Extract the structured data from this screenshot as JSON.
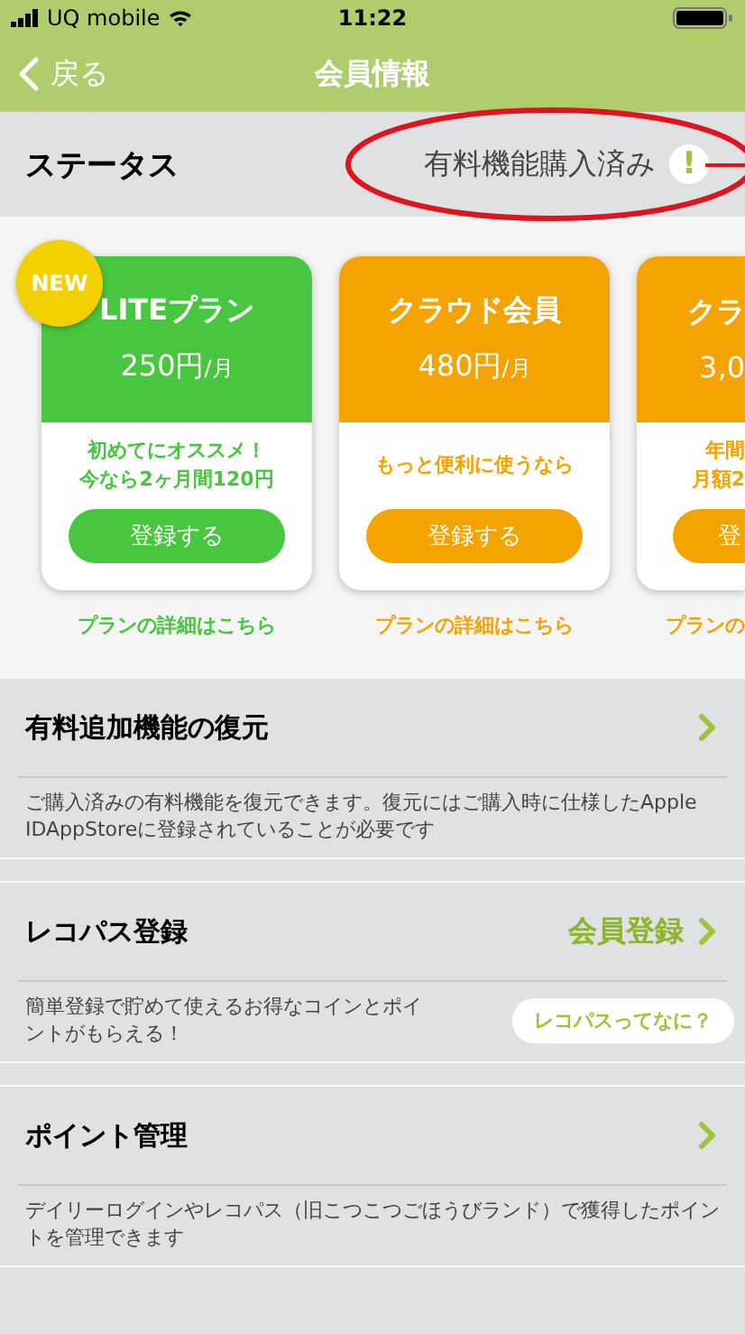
{
  "status_bar": {
    "carrier": "UQ mobile",
    "time": "11:22"
  },
  "nav": {
    "back": "戻る",
    "title": "会員情報"
  },
  "status_row": {
    "label": "ステータス",
    "value": "有料機能購入済み",
    "alert": "!"
  },
  "plans": [
    {
      "name": "LITEプラン",
      "price": "250円",
      "unit": "/月",
      "badge": "NEW",
      "note": [
        "初めてにオススメ！",
        "今なら2ヶ月間120円"
      ],
      "button": "登録する",
      "link": "プランの詳細はこちら",
      "color": "#48c640",
      "partial": false
    },
    {
      "name": "クラウド会員",
      "price": "480円",
      "unit": "/月",
      "note": [
        "もっと便利に使うなら"
      ],
      "button": "登録する",
      "link": "プランの詳細はこちら",
      "color": "#f5a300",
      "partial": false
    },
    {
      "name": "クラ",
      "price": "3,0",
      "note": [
        "年間",
        "月額2"
      ],
      "button": "登",
      "link": "プランの",
      "color": "#f5a300",
      "partial": true
    }
  ],
  "sections": [
    {
      "title": "有料追加機能の復元",
      "description": "ご購入済みの有料機能を復元できます。復元にはご購入時に仕様したApple IDAppStoreに登録されていることが必要です"
    },
    {
      "title": "レコパス登録",
      "action": "会員登録",
      "description": "簡単登録で貯めて使えるお得なコインとポイントがもらえる！",
      "pill": "レコパスってなに？"
    },
    {
      "title": "ポイント管理",
      "description": "デイリーログインやレコパス（旧こつこつごほうびランド）で獲得したポイントを管理できます"
    }
  ]
}
